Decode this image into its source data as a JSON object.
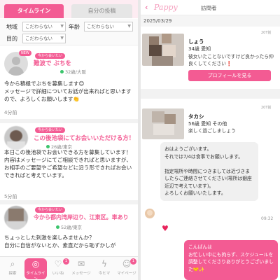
{
  "left": {
    "tabs": {
      "timeline": "タイムライン",
      "my_posts": "自分の投稿"
    },
    "filter": {
      "area_label": "地域",
      "area_value": "こだわらない",
      "age_label": "年齢",
      "age_value": "こだわらない",
      "purpose_label": "目的",
      "purpose_value": "こだわらない"
    },
    "posts": [
      {
        "new_badge": "NEW",
        "tag": "今から会いたい",
        "title": "難波で ぶちを",
        "meta": "32歳/大阪",
        "body": "今から積極でぶちを募集します😊\nメッセージで詳細についてお話が出来ればと思いますので、よろしくお願いします👏",
        "time": "4分前"
      },
      {
        "tag": "今から会いたい",
        "title": "この後池袋にてお会いいただける方！",
        "meta": "26歳/東京",
        "body": "本日この後池袋でお会いできる方を募集しています！\n内容はメッセージにてご相談できればと思いますが、お相手のご要望やご希望などに沿う形できればお会いできればと考えています。",
        "time": "5分前"
      },
      {
        "tag": "今から会いたい",
        "title": "今から都内湾岸辺り、江東区。車あり",
        "meta": "52歳/東京",
        "body": "ちょっとした刺激を楽しみませんか？\n自分に自信がないとか、素直だから恥ずかしが"
      }
    ],
    "nav": [
      {
        "icon": "search-icon",
        "label": "探索"
      },
      {
        "icon": "timeline-icon",
        "label": "タイムライン"
      },
      {
        "icon": "heart-icon",
        "label": "いいね",
        "badge": "1"
      },
      {
        "icon": "mail-icon",
        "label": "メッセージ"
      },
      {
        "icon": "lightning-icon",
        "label": "今ヒマ"
      },
      {
        "icon": "person-icon",
        "label": "マイページ",
        "badge": "1"
      }
    ]
  },
  "right": {
    "header": {
      "back": "‹",
      "logo": "Pappy",
      "title": "訪問者"
    },
    "date": "2025/03/29",
    "visitors": [
      {
        "time": "20T前",
        "name": "しょう",
        "info": "34歳 愛知",
        "message": "彼女いたことないですけど良かったら仲良くしてください❗",
        "button": "プロフィールを見る"
      },
      {
        "time": "20T前",
        "name": "タカシ",
        "info": "56歳 愛知 その他",
        "message": "楽しく過ごしましょう"
      }
    ],
    "chat": {
      "incoming": "おはようございます。\nそれでは7/4は食事でお願いします。\n\n指定場所や時間につきましては近づきましたらご連絡させてください(場所は銀座近辺で考えています)。\nよろしくお願いいたします。",
      "incoming_time": "09:32",
      "outgoing": "こんばんは\nお忙しい中にも拘らず、スケジュールを調整してくださりありがとうございました🤝✨"
    }
  },
  "colors": {
    "accent": "#f35b93",
    "online": "#3bc46c"
  }
}
